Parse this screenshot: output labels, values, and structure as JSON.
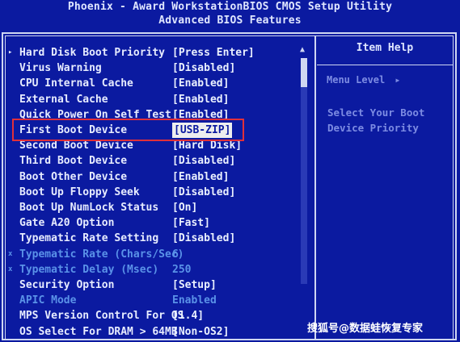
{
  "header": {
    "line1": "Phoenix - Award WorkstationBIOS CMOS Setup Utility",
    "line2": "Advanced BIOS Features"
  },
  "rows": [
    {
      "label": "Hard Disk Boot Priority",
      "value": "[Press Enter]",
      "marker": "▸",
      "dim": false
    },
    {
      "label": "Virus Warning",
      "value": "[Disabled]",
      "marker": "",
      "dim": false
    },
    {
      "label": "CPU Internal Cache",
      "value": "[Enabled]",
      "marker": "",
      "dim": false
    },
    {
      "label": "External Cache",
      "value": "[Enabled]",
      "marker": "",
      "dim": false
    },
    {
      "label": "Quick Power On Self Test",
      "value": "[Enabled]",
      "marker": "",
      "dim": false
    },
    {
      "label": "First Boot Device",
      "value": "[USB-ZIP]",
      "marker": "",
      "dim": false,
      "highlighted": true
    },
    {
      "label": "Second Boot Device",
      "value": "[Hard Disk]",
      "marker": "",
      "dim": false
    },
    {
      "label": "Third Boot Device",
      "value": "[Disabled]",
      "marker": "",
      "dim": false
    },
    {
      "label": "Boot Other Device",
      "value": "[Enabled]",
      "marker": "",
      "dim": false
    },
    {
      "label": "Boot Up Floppy Seek",
      "value": "[Disabled]",
      "marker": "",
      "dim": false
    },
    {
      "label": "Boot Up NumLock Status",
      "value": "[On]",
      "marker": "",
      "dim": false
    },
    {
      "label": "Gate A20 Option",
      "value": "[Fast]",
      "marker": "",
      "dim": false
    },
    {
      "label": "Typematic Rate Setting",
      "value": "[Disabled]",
      "marker": "",
      "dim": false
    },
    {
      "label": "Typematic Rate (Chars/Sec)",
      "value": "6",
      "marker": "x",
      "dim": true
    },
    {
      "label": "Typematic Delay (Msec)",
      "value": "250",
      "marker": "x",
      "dim": true
    },
    {
      "label": "Security Option",
      "value": "[Setup]",
      "marker": "",
      "dim": false
    },
    {
      "label": "APIC Mode",
      "value": "Enabled",
      "marker": "",
      "dim": true
    },
    {
      "label": "MPS Version Control For OS",
      "value": "[1.4]",
      "marker": "",
      "dim": false
    },
    {
      "label": "OS Select For DRAM > 64MB",
      "value": "[Non-OS2]",
      "marker": "",
      "dim": false
    }
  ],
  "help": {
    "title": "Item Help",
    "menu_level": "Menu Level",
    "menu_level_arrow": "▸",
    "text": "Select Your Boot Device Priority"
  },
  "scroll_up_glyph": "▲",
  "watermark": "搜狐号@数据蛙恢复专家",
  "colors": {
    "background": "#0b1aa0",
    "text": "#e7ecff",
    "dim_text": "#5a92e8",
    "help_text": "#7d8ce3",
    "highlight_bg": "#eeeeee",
    "annotation_red": "#e0303a"
  }
}
